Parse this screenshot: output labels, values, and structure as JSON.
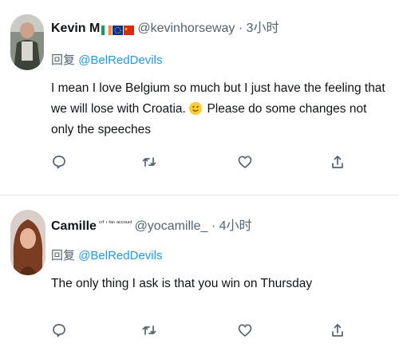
{
  "tweets": [
    {
      "name": "Kevin M",
      "flags": [
        "ireland-flag",
        "eu-flag",
        "china-flag"
      ],
      "name_suffix": "",
      "handle": "@kevinhorseway",
      "time": "· 3小时",
      "reply_prefix": "回复",
      "reply_to": "@BelRedDevils",
      "text_before_emoji": "I mean I love Belgium so much but I just have the feeling that we will lose with Croatia.",
      "text_after_emoji": "Please do some changes not only the speeches",
      "emoji": "smiley-emoji",
      "actions": [
        "reply-icon",
        "retweet-icon",
        "like-icon",
        "share-icon"
      ]
    },
    {
      "name": "Camille",
      "name_suffix": "ᶜʳᶠ ᶦ ᶠᵃⁿ ᵃᶜᶜᵒᵘⁿᵗ",
      "handle": "@yocamille_",
      "time": "· 4小时",
      "reply_prefix": "回复",
      "reply_to": "@BelRedDevils",
      "text": "The only thing I ask is that you win on Thursday",
      "actions": [
        "reply-icon",
        "retweet-icon",
        "like-icon",
        "share-icon"
      ]
    }
  ],
  "colors": {
    "link": "#1d9bf0",
    "muted": "#536471",
    "text": "#0f1419",
    "divider": "#e6e9ec"
  }
}
